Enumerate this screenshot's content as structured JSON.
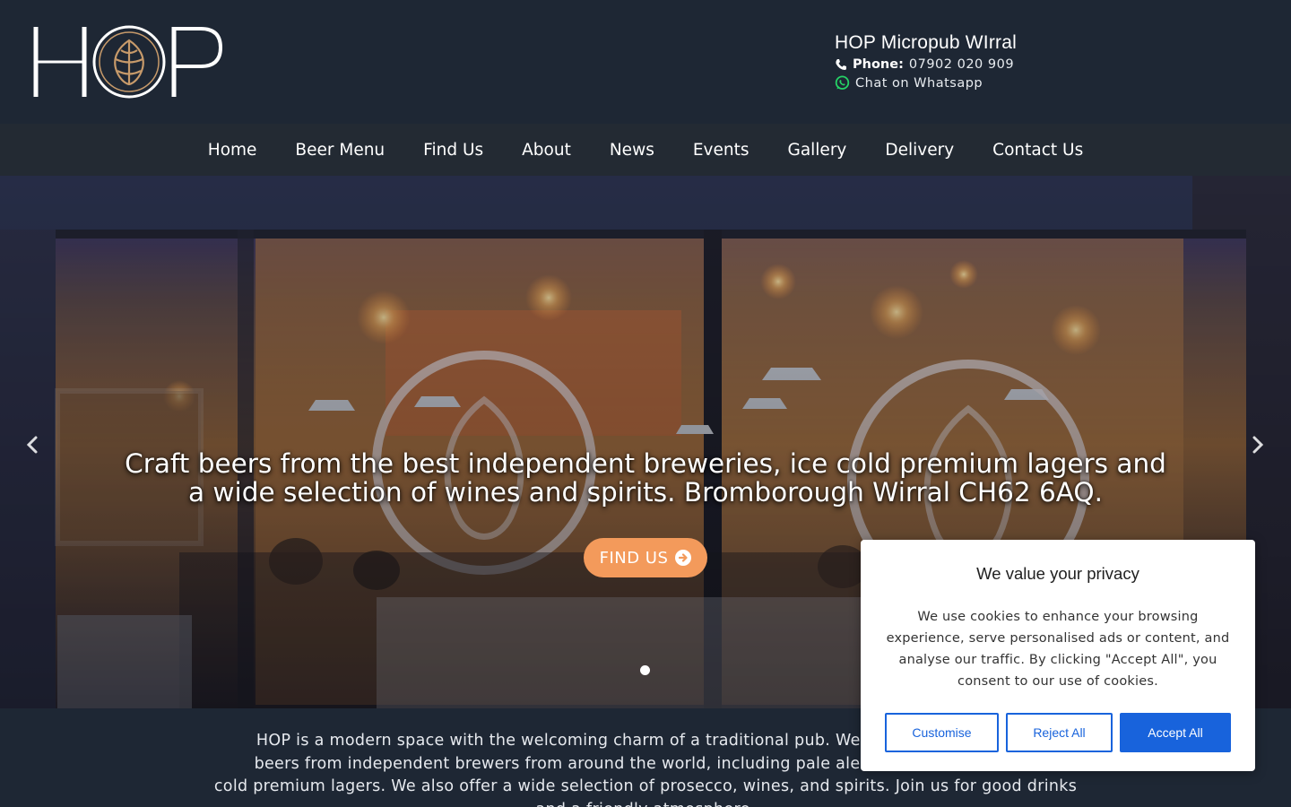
{
  "brand": {
    "logo_text": "HOP"
  },
  "contact": {
    "title": "HOP Micropub WIrral",
    "phone_label": "Phone:",
    "phone_number": "07902 020 909",
    "whatsapp_label": "Chat on Whatsapp"
  },
  "nav": {
    "items": [
      {
        "label": "Home"
      },
      {
        "label": "Beer Menu"
      },
      {
        "label": "Find Us"
      },
      {
        "label": "About"
      },
      {
        "label": "News"
      },
      {
        "label": "Events"
      },
      {
        "label": "Gallery"
      },
      {
        "label": "Delivery"
      },
      {
        "label": "Contact Us"
      }
    ]
  },
  "hero": {
    "line1": "Craft beers from the best independent breweries, ice cold premium lagers and",
    "line2": "a wide selection of wines and spirits. Bromborough Wirral CH62 6AQ.",
    "button_label": "FIND US",
    "icons": {
      "prev": "chevron-left-icon",
      "next": "chevron-right-icon",
      "button": "arrow-circle-right-icon"
    }
  },
  "intro": {
    "line1": "HOP is a modern space with the welcoming charm of a traditional pub. We offer a range of craft",
    "line2": "beers from independent brewers from around the world, including pale ales, IPAs, stouts and ice",
    "line3": "cold premium lagers. We also offer a wide selection of prosecco, wines, and spirits. Join us for good drinks",
    "line4": "and a friendly atmosphere."
  },
  "cookie": {
    "title": "We value your privacy",
    "text": "We use cookies to enhance your browsing experience, serve personalised ads or content, and analyse our traffic. By clicking \"Accept All\", you consent to our use of cookies.",
    "customise_label": "Customise",
    "reject_label": "Reject All",
    "accept_label": "Accept All"
  },
  "colors": {
    "header_bg": "#1e2734",
    "nav_bg": "#232a33",
    "accent_orange": "#f39a5b",
    "logo_hop_gold": "#c79a6a",
    "cookie_blue": "#1863dc",
    "whatsapp_green": "#25d366"
  }
}
